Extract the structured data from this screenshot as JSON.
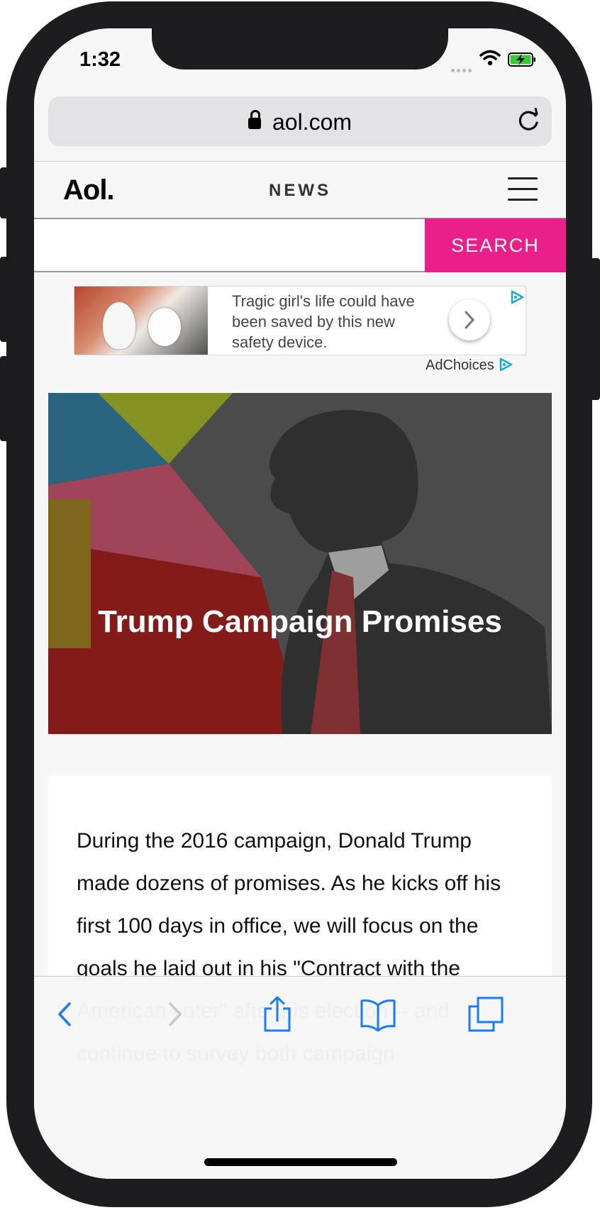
{
  "status_bar": {
    "time": "1:32"
  },
  "browser": {
    "url": "aol.com"
  },
  "site": {
    "logo": "Aol.",
    "section": "NEWS",
    "search_button": "SEARCH",
    "search_placeholder": ""
  },
  "ad": {
    "text": "Tragic girl's life could have been saved by this new safety device.",
    "adchoices_label": "AdChoices"
  },
  "hero": {
    "title": "Trump Campaign Promises"
  },
  "article": {
    "body": "During the 2016 campaign, Donald Trump made dozens of promises. As he kicks off his first 100 days in office, we will focus on the goals he laid out in his \"Contract with the American voter\" after his election -- and continue to survey both campaign"
  },
  "colors": {
    "accent": "#ea1f8a",
    "ios_blue": "#1a7cf5"
  },
  "toolbar": {
    "icons": [
      "back-icon",
      "forward-icon",
      "share-icon",
      "bookmarks-icon",
      "tabs-icon"
    ]
  }
}
